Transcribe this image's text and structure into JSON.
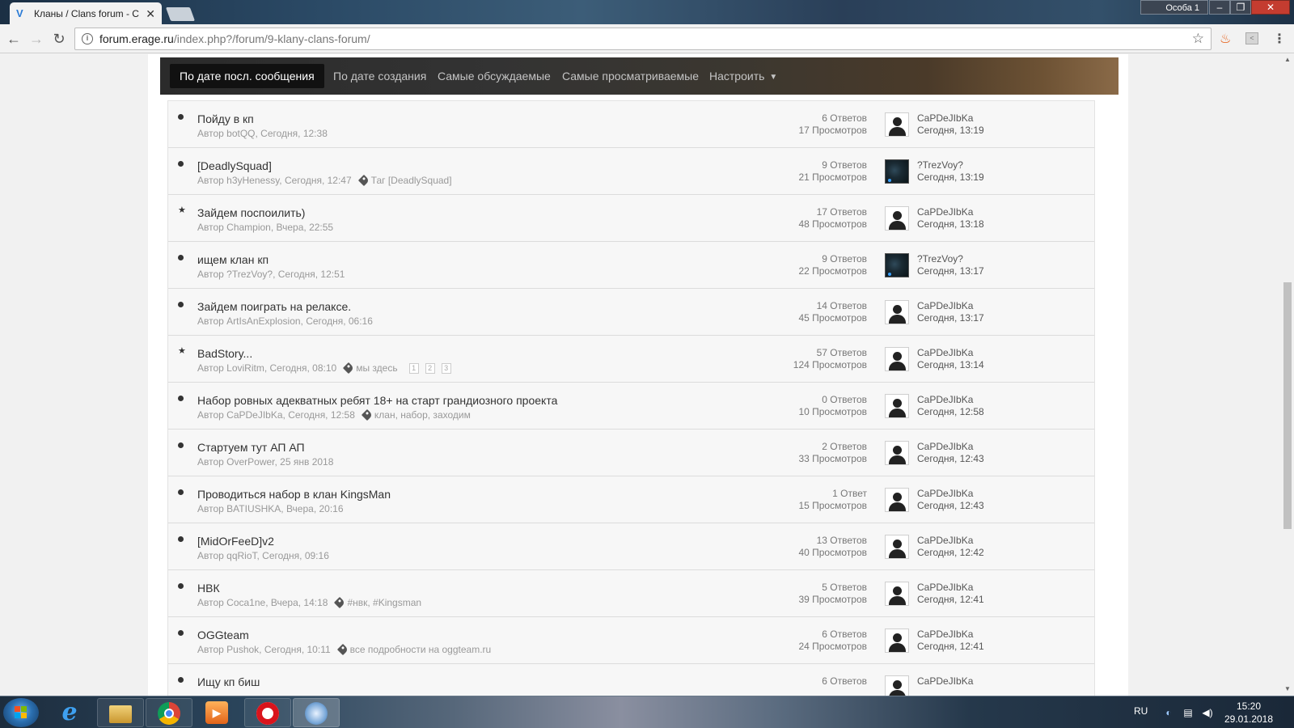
{
  "browser": {
    "tab_title": "Кланы / Clans forum - C",
    "tab_icon": "forum-v-icon",
    "url_host": "forum.erage.ru",
    "url_path": "/index.php?/forum/9-klany-clans-forum/",
    "profile": "Особа 1"
  },
  "sortbar": {
    "items": [
      {
        "label": "По дате посл. сообщения",
        "active": true
      },
      {
        "label": "По дате создания",
        "active": false
      },
      {
        "label": "Самые обсуждаемые",
        "active": false
      },
      {
        "label": "Самые просматриваемые",
        "active": false
      },
      {
        "label": "Настроить",
        "active": false
      }
    ]
  },
  "topics": [
    {
      "status": "dot",
      "title": "Пойду в кп",
      "author": "Автор botQQ, Сегодня, 12:38",
      "tag": "",
      "pages": [],
      "replies": "6 Ответов",
      "views": "17 Просмотров",
      "avatar": "default",
      "last_user": "CaPDeJIbKa",
      "last_time": "Сегодня, 13:19"
    },
    {
      "status": "dot",
      "title": "[DeadlySquad]",
      "author": "Автор h3yHenessy, Сегодня, 12:47",
      "tag": "Таг [DeadlySquad]",
      "pages": [],
      "replies": "9 Ответов",
      "views": "21 Просмотров",
      "avatar": "dark",
      "last_user": "?TrezVoy?",
      "last_time": "Сегодня, 13:19"
    },
    {
      "status": "star",
      "title": "Зайдем поспоилить)",
      "author": "Автор Champion, Вчера, 22:55",
      "tag": "",
      "pages": [],
      "replies": "17 Ответов",
      "views": "48 Просмотров",
      "avatar": "default",
      "last_user": "CaPDeJIbKa",
      "last_time": "Сегодня, 13:18"
    },
    {
      "status": "dot",
      "title": "ищем клан кп",
      "author": "Автор ?TrezVoy?, Сегодня, 12:51",
      "tag": "",
      "pages": [],
      "replies": "9 Ответов",
      "views": "22 Просмотров",
      "avatar": "dark",
      "last_user": "?TrezVoy?",
      "last_time": "Сегодня, 13:17"
    },
    {
      "status": "dot",
      "title": "Зайдем поиграть на релаксе.",
      "author": "Автор ArtIsAnExplosion, Сегодня, 06:16",
      "tag": "",
      "pages": [],
      "replies": "14 Ответов",
      "views": "45 Просмотров",
      "avatar": "default",
      "last_user": "CaPDeJIbKa",
      "last_time": "Сегодня, 13:17"
    },
    {
      "status": "star",
      "title": "BadStory...",
      "author": "Автор LoviRitm, Сегодня, 08:10",
      "tag": "мы здесь",
      "pages": [
        "1",
        "2",
        "3"
      ],
      "replies": "57 Ответов",
      "views": "124 Просмотров",
      "avatar": "default",
      "last_user": "CaPDeJIbKa",
      "last_time": "Сегодня, 13:14"
    },
    {
      "status": "dot",
      "title": "Набор ровных адекватных ребят 18+ на старт грандиозного проекта",
      "author": "Автор CaPDeJIbKa, Сегодня, 12:58",
      "tag": "клан, набор, заходим",
      "pages": [],
      "replies": "0 Ответов",
      "views": "10 Просмотров",
      "avatar": "default",
      "last_user": "CaPDeJIbKa",
      "last_time": "Сегодня, 12:58"
    },
    {
      "status": "dot",
      "title": "Стартуем тут АП АП",
      "author": "Автор OverPower, 25 янв 2018",
      "tag": "",
      "pages": [],
      "replies": "2 Ответов",
      "views": "33 Просмотров",
      "avatar": "default",
      "last_user": "CaPDeJIbKa",
      "last_time": "Сегодня, 12:43"
    },
    {
      "status": "dot",
      "title": "Проводиться набор в клан KingsMan",
      "author": "Автор BATIUSHKA, Вчера, 20:16",
      "tag": "",
      "pages": [],
      "replies": "1 Ответ",
      "views": "15 Просмотров",
      "avatar": "default",
      "last_user": "CaPDeJIbKa",
      "last_time": "Сегодня, 12:43"
    },
    {
      "status": "dot",
      "title": "[MidOrFeeD]v2",
      "author": "Автор qqRioT, Сегодня, 09:16",
      "tag": "",
      "pages": [],
      "replies": "13 Ответов",
      "views": "40 Просмотров",
      "avatar": "default",
      "last_user": "CaPDeJIbKa",
      "last_time": "Сегодня, 12:42"
    },
    {
      "status": "dot",
      "title": "НВК",
      "author": "Автор Coca1ne, Вчера, 14:18",
      "tag": "#нвк, #Kingsman",
      "pages": [],
      "replies": "5 Ответов",
      "views": "39 Просмотров",
      "avatar": "default",
      "last_user": "CaPDeJIbKa",
      "last_time": "Сегодня, 12:41"
    },
    {
      "status": "dot",
      "title": "OGGteam",
      "author": "Автор Pushok, Сегодня, 10:11",
      "tag": "все подробности на oggteam.ru",
      "pages": [],
      "replies": "6 Ответов",
      "views": "24 Просмотров",
      "avatar": "default",
      "last_user": "CaPDeJIbKa",
      "last_time": "Сегодня, 12:41"
    },
    {
      "status": "dot",
      "title": "Ищу кп биш",
      "author": "",
      "tag": "",
      "pages": [],
      "replies": "6 Ответов",
      "views": "",
      "avatar": "default",
      "last_user": "CaPDeJIbKa",
      "last_time": ""
    }
  ],
  "taskbar": {
    "lang": "RU",
    "time": "15:20",
    "date": "29.01.2018",
    "apps": [
      "start-orb",
      "internet-explorer-icon",
      "file-explorer-icon",
      "chrome-icon",
      "media-player-icon",
      "opera-icon",
      "game-launcher-icon"
    ]
  }
}
